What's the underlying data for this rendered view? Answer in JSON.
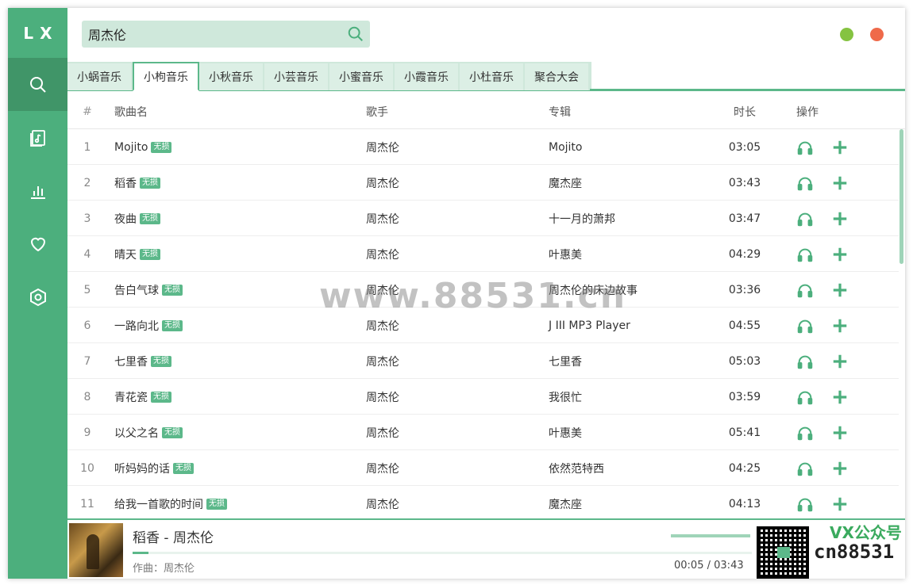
{
  "app": {
    "logo": "LX"
  },
  "sidebar": {
    "items": [
      {
        "icon": "search-icon",
        "active": true
      },
      {
        "icon": "music-list-icon",
        "active": false
      },
      {
        "icon": "chart-icon",
        "active": false
      },
      {
        "icon": "heart-icon",
        "active": false
      },
      {
        "icon": "settings-icon",
        "active": false
      }
    ]
  },
  "search": {
    "value": "周杰伦"
  },
  "colors": {
    "accent": "#4caf7d",
    "minimize": "#85c341",
    "close": "#ef6a4a"
  },
  "tabs": [
    "小蜗音乐",
    "小枸音乐",
    "小秋音乐",
    "小芸音乐",
    "小蜜音乐",
    "小霞音乐",
    "小杜音乐",
    "聚合大会"
  ],
  "active_tab": 1,
  "table": {
    "headers": {
      "num": "#",
      "name": "歌曲名",
      "singer": "歌手",
      "album": "专辑",
      "duration": "时长",
      "ops": "操作"
    },
    "badge": "无损",
    "rows": [
      {
        "num": "1",
        "name": "Mojito",
        "singer": "周杰伦",
        "album": "Mojito",
        "duration": "03:05"
      },
      {
        "num": "2",
        "name": "稻香",
        "singer": "周杰伦",
        "album": "魔杰座",
        "duration": "03:43"
      },
      {
        "num": "3",
        "name": "夜曲",
        "singer": "周杰伦",
        "album": "十一月的萧邦",
        "duration": "03:47"
      },
      {
        "num": "4",
        "name": "晴天",
        "singer": "周杰伦",
        "album": "叶惠美",
        "duration": "04:29"
      },
      {
        "num": "5",
        "name": "告白气球",
        "singer": "周杰伦",
        "album": "周杰伦的床边故事",
        "duration": "03:36"
      },
      {
        "num": "6",
        "name": "一路向北",
        "singer": "周杰伦",
        "album": "J III MP3 Player",
        "duration": "04:55"
      },
      {
        "num": "7",
        "name": "七里香",
        "singer": "周杰伦",
        "album": "七里香",
        "duration": "05:03"
      },
      {
        "num": "8",
        "name": "青花瓷",
        "singer": "周杰伦",
        "album": "我很忙",
        "duration": "03:59"
      },
      {
        "num": "9",
        "name": "以父之名",
        "singer": "周杰伦",
        "album": "叶惠美",
        "duration": "05:41"
      },
      {
        "num": "10",
        "name": "听妈妈的话",
        "singer": "周杰伦",
        "album": "依然范特西",
        "duration": "04:25"
      },
      {
        "num": "11",
        "name": "给我一首歌的时间",
        "singer": "周杰伦",
        "album": "魔杰座",
        "duration": "04:13"
      }
    ]
  },
  "player": {
    "title": "稻香 - 周杰伦",
    "composer": "作曲：周杰伦",
    "current_time": "00:05",
    "separator": "/",
    "total_time": "03:43",
    "progress": 0.025
  },
  "watermark": {
    "center": "www.88531.cn",
    "corner": "cn88531",
    "corner_logo": "VX公众号"
  }
}
